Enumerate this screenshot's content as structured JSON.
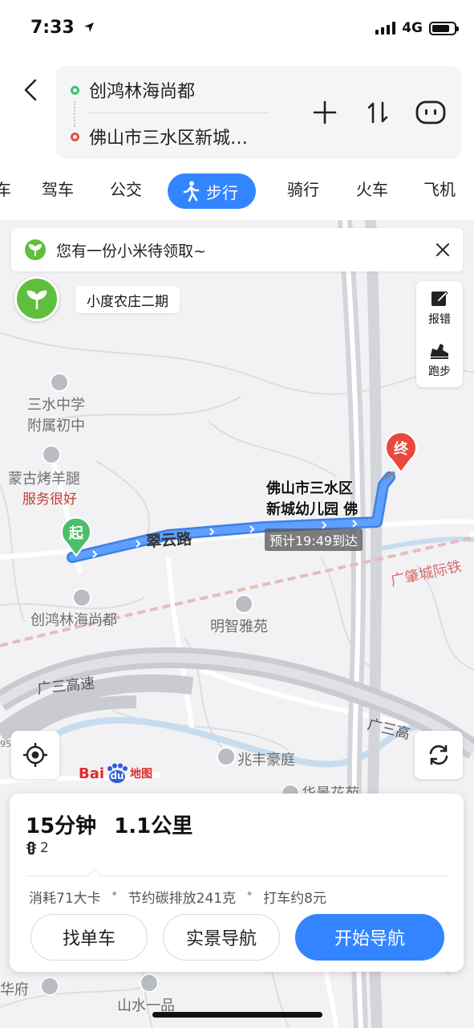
{
  "status_bar": {
    "time": "7:33",
    "network": "4G"
  },
  "route": {
    "start": "创鸿林海尚都",
    "end": "佛山市三水区新城…"
  },
  "tabs": {
    "partial": "车",
    "drive": "驾车",
    "bus": "公交",
    "walk": "步行",
    "ride": "骑行",
    "train": "火车",
    "plane": "飞机"
  },
  "banner": {
    "text": "您有一份小米待领取~"
  },
  "farm": {
    "label": "小度农庄二期"
  },
  "side_tools": {
    "report": "报错",
    "run": "跑步"
  },
  "map": {
    "labels": {
      "school": "三水中学\n附属初中",
      "restaurant": "蒙古烤羊腿",
      "restaurant_tag": "服务很好",
      "road": "翠云路",
      "origin_poi": "创鸿林海尚都",
      "mingzhi": "明智雅苑",
      "railway": "广肇城际铁",
      "highway1": "广三高速",
      "highway2": "广三高",
      "zhaofeng": "兆丰豪庭",
      "huajing": "华景花苑",
      "huafu": "华府",
      "shanshui": "山水一品",
      "start_marker": "起",
      "end_marker": "终",
      "edge_num": "95"
    },
    "destination": "佛山市三水区\n新城幼儿园 佛",
    "eta": "预计19:49到达",
    "logo": {
      "bai": "Bai",
      "du": "du",
      "map": "地图"
    }
  },
  "card": {
    "duration": "15分钟",
    "distance": "1.1公里",
    "crossings": "2",
    "calories": "消耗71大卡",
    "carbon": "节约碳排放241克",
    "taxi": "打车约8元",
    "btn_bike": "找单车",
    "btn_ar": "实景导航",
    "btn_start": "开始导航"
  },
  "colors": {
    "accent": "#3385ff",
    "route": "#4a8ef0",
    "start": "#3cc173",
    "end": "#e2503f"
  }
}
